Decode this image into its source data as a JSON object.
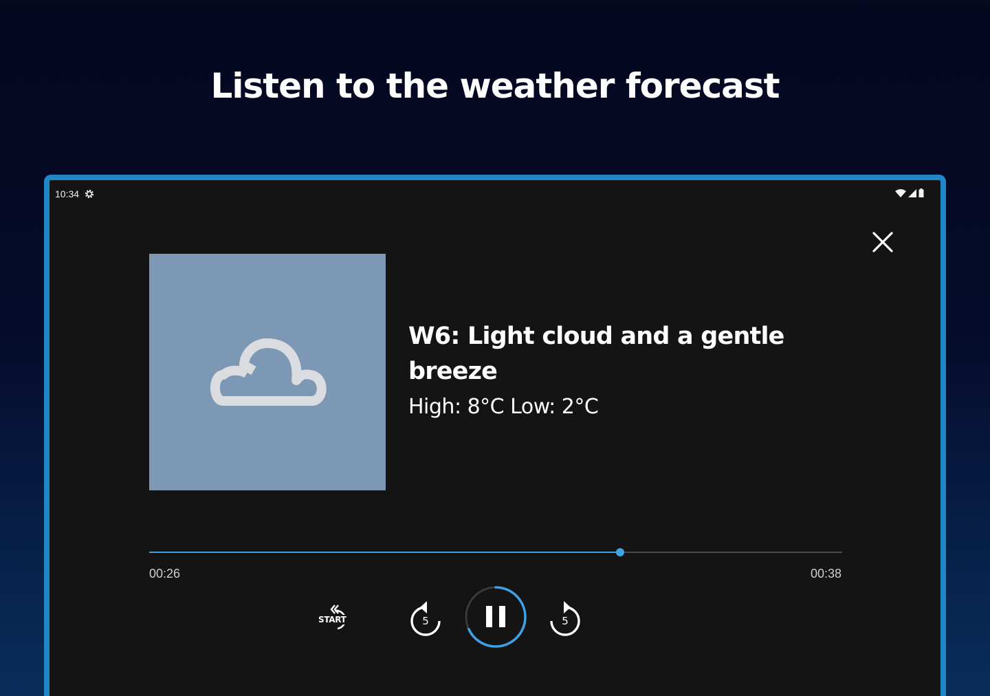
{
  "headline": "Listen to the weather forecast",
  "status_bar": {
    "time": "10:34",
    "icons": [
      "settings-gear-icon",
      "wifi-icon",
      "cell-signal-icon",
      "battery-icon"
    ]
  },
  "player": {
    "artwork_icon": "cloud-icon",
    "artwork_color": "#7c98b5",
    "title": "W6: Light cloud and a gentle breeze",
    "temperatures": "High: 8°C Low: 2°C",
    "progress_fraction": 0.68,
    "elapsed": "00:26",
    "total": "00:38",
    "accent_color": "#3ea2e5",
    "controls": {
      "start_label": "START",
      "rewind_seconds": "5",
      "forward_seconds": "5",
      "state": "playing"
    }
  },
  "close_icon": "close-icon"
}
